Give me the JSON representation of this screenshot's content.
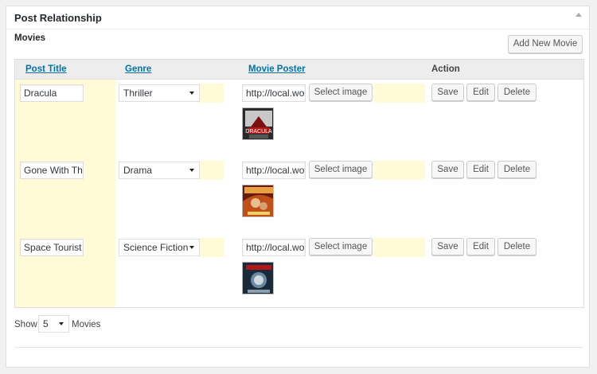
{
  "panel": {
    "title": "Post Relationship",
    "section_label": "Movies",
    "add_button": "Add New Movie"
  },
  "columns": {
    "title": "Post Title",
    "genre": "Genre",
    "poster": "Movie Poster",
    "action": "Action"
  },
  "rows": [
    {
      "title": "Dracula",
      "genre": "Thriller",
      "poster_url": "http://local.wordpress",
      "poster_icon": "dracula-poster",
      "poster_colors": [
        "#7a1010",
        "#c8c8c8",
        "#2a2a2a"
      ]
    },
    {
      "title": "Gone With The Wind",
      "genre": "Drama",
      "poster_url": "http://local.wordpress",
      "poster_icon": "gone-with-the-wind-poster",
      "poster_colors": [
        "#c0501a",
        "#e8a040",
        "#6a1a0a"
      ]
    },
    {
      "title": "Space Tourist",
      "genre": "Science Fiction",
      "poster_url": "http://local.wordpress",
      "poster_icon": "space-tourist-poster",
      "poster_colors": [
        "#1a2a3a",
        "#6a8aa0",
        "#b01818"
      ]
    }
  ],
  "buttons": {
    "select_image": "Select image",
    "save": "Save",
    "edit": "Edit",
    "delete": "Delete"
  },
  "footer": {
    "show_label": "Show",
    "per_page": "5",
    "suffix": "Movies"
  },
  "colors": {
    "highlight": "#fffbd6",
    "link": "#0073aa",
    "header_bg": "#ededed"
  }
}
